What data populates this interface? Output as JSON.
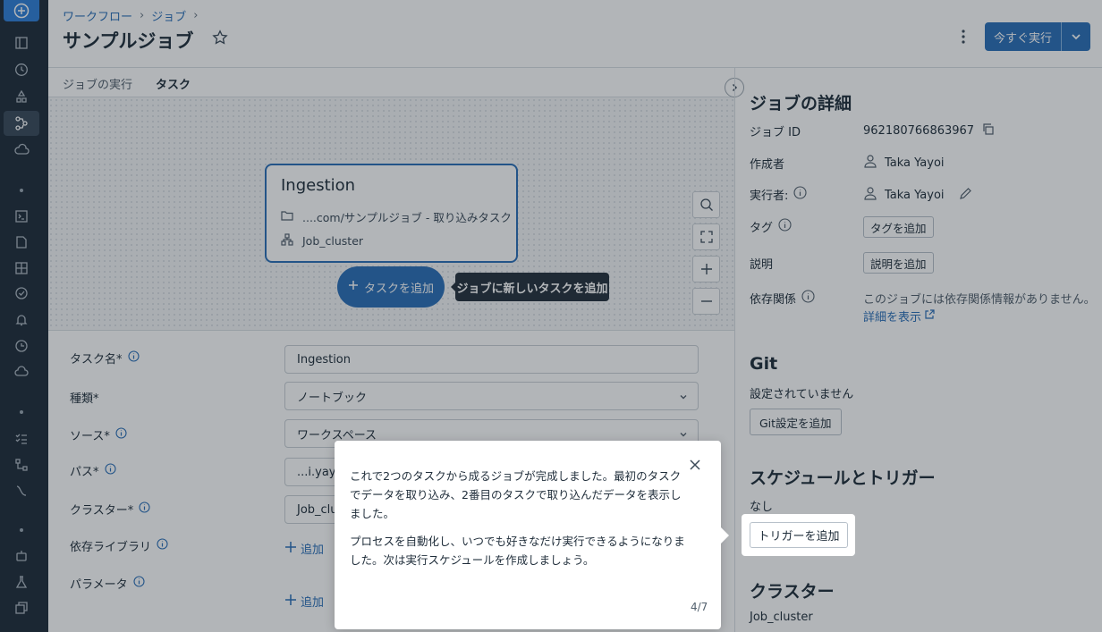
{
  "breadcrumb": {
    "items": [
      "ワークフロー",
      "ジョブ"
    ]
  },
  "page": {
    "title": "サンプルジョブ",
    "run_label": "今すぐ実行"
  },
  "tabs": [
    {
      "label": "ジョブの実行"
    },
    {
      "label": "タスク"
    }
  ],
  "task_card": {
    "name": "Ingestion",
    "path": "....com/サンプルジョブ - 取り込みタスク",
    "cluster": "Job_cluster"
  },
  "canvas": {
    "add_task_label": "タスクを追加",
    "tooltip": "ジョブに新しいタスクを追加"
  },
  "form": {
    "task_name_label": "タスク名*",
    "task_name_value": "Ingestion",
    "type_label": "種類*",
    "type_value": "ノートブック",
    "source_label": "ソース*",
    "source_value": "ワークスペース",
    "path_label": "パス*",
    "path_value": "...i.yayo",
    "cluster_label": "クラスター*",
    "cluster_value": "Job_clu",
    "libraries_label": "依存ライブラリ",
    "params_label": "パラメータ",
    "add_label": "追加"
  },
  "details": {
    "heading": "ジョブの詳細",
    "job_id_label": "ジョブ ID",
    "job_id": "962180766863967",
    "creator_label": "作成者",
    "creator": "Taka Yayoi",
    "run_as_label": "実行者:",
    "run_as": "Taka Yayoi",
    "tags_label": "タグ",
    "tags_button": "タグを追加",
    "desc_label": "説明",
    "desc_button": "説明を追加",
    "deps_label": "依存関係",
    "deps_text": "このジョブには依存関係情報がありません。",
    "deps_link": "詳細を表示"
  },
  "git": {
    "heading": "Git",
    "status": "設定されていません",
    "button": "Git設定を追加"
  },
  "schedule": {
    "heading": "スケジュールとトリガー",
    "status": "なし",
    "button": "トリガーを追加"
  },
  "cluster": {
    "heading": "クラスター",
    "name": "Job_cluster"
  },
  "tour": {
    "para1": "これで2つのタスクから成るジョブが完成しました。最初のタスクでデータを取り込み、2番目のタスクで取り込んだデータを表示しました。",
    "para2": "プロセスを自動化し、いつでも好きなだけ実行できるようになりました。次は実行スケジュールを作成しましょう。",
    "step": "4/7"
  },
  "colors": {
    "accent": "#2a6fb8",
    "rail": "#1e2c3a"
  }
}
